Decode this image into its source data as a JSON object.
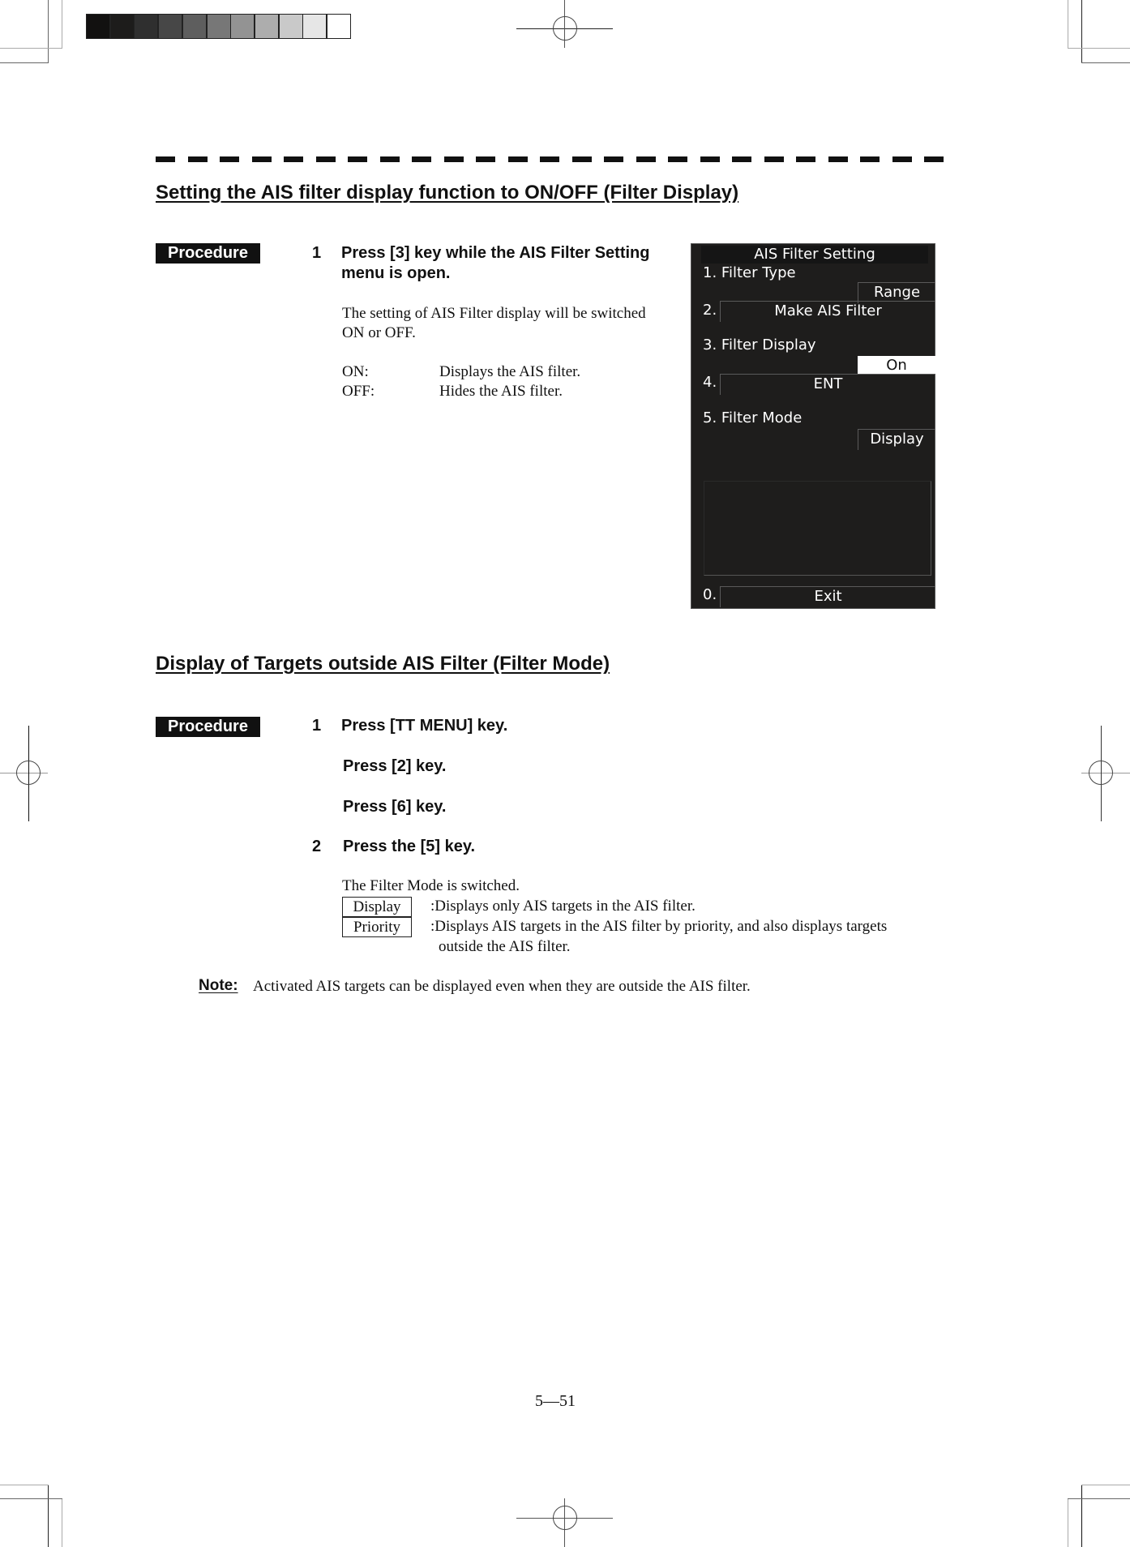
{
  "calibration_strip": {
    "shades": [
      "#121110",
      "#1d1c1b",
      "#2f2f2f",
      "#474747",
      "#5e5e5e",
      "#777777",
      "#939393",
      "#adadad",
      "#c9c9c9",
      "#e6e6e6",
      "#ffffff"
    ]
  },
  "section1": {
    "title": "Setting the AIS filter display function to ON/OFF (Filter Display)",
    "procedure_label": "Procedure",
    "step1": {
      "number": "1",
      "line1": "Press [3] key while the AIS Filter Setting",
      "line2": "menu is open."
    },
    "desc_line1": "The setting of AIS Filter display will be switched",
    "desc_line2": "ON or OFF.",
    "options": [
      {
        "term": "ON:",
        "desc": "Displays the AIS filter."
      },
      {
        "term": "OFF:",
        "desc": "Hides the AIS filter."
      }
    ]
  },
  "menu": {
    "title": "AIS Filter Setting",
    "items": [
      {
        "number": "1.",
        "label": "Filter Type",
        "value": "Range"
      },
      {
        "number": "2.",
        "label": "Make AIS Filter"
      },
      {
        "number": "3.",
        "label": "Filter Display",
        "value": "On"
      },
      {
        "number": "4.",
        "label": "ENT"
      },
      {
        "number": "5.",
        "label": "Filter Mode",
        "value": "Display"
      },
      {
        "number": "0.",
        "label": "Exit"
      }
    ]
  },
  "section2": {
    "title": "Display of Targets outside AIS Filter (Filter Mode)",
    "procedure_label": "Procedure",
    "steps": [
      {
        "number": "1",
        "text": "Press [TT MENU] key."
      },
      {
        "number": "",
        "text": "Press [2] key."
      },
      {
        "number": "",
        "text": "Press [6] key."
      },
      {
        "number": "2",
        "text": "Press the [5] key."
      }
    ],
    "desc": "The Filter Mode is switched.",
    "modes": [
      {
        "key": "Display",
        "desc": ":Displays only AIS targets in the AIS filter."
      },
      {
        "key": "Priority",
        "desc": ":Displays AIS targets in the AIS filter by priority, and also displays targets",
        "desc2": "outside the AIS filter."
      }
    ]
  },
  "note": {
    "label": "Note:",
    "text": "Activated AIS targets can be displayed even when they are outside the AIS filter."
  },
  "page_number": "5—51"
}
